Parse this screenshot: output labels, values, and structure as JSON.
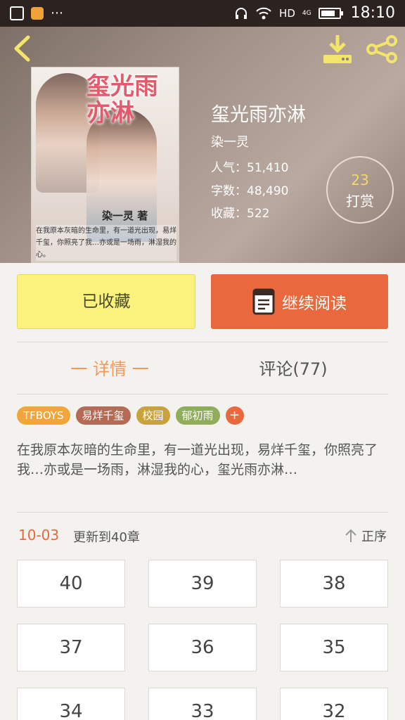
{
  "status_bar": {
    "network": "HD",
    "signal_label": "4G",
    "time": "18:10",
    "battery_level": 0.8
  },
  "book": {
    "title": "玺光雨亦淋",
    "author": "染一灵",
    "popularity": "人气：51,410",
    "word_count": "字数：48,490",
    "favorites": "收藏：522",
    "tip_count": "23",
    "tip_label": "打赏"
  },
  "cover": {
    "title": "玺光雨亦淋",
    "author_credit": "染一灵 著",
    "blurb": "在我原本灰暗的生命里，有一道光出现，易烊千玺，你照亮了我…亦或是一场雨，淋湿我的心。"
  },
  "actions": {
    "favorite_label": "已收藏",
    "read_label": "继续阅读"
  },
  "tabs": {
    "details": "一 详情 一",
    "comments": "评论(77)"
  },
  "tags": [
    {
      "label": "TFBOYS",
      "color": "#f0a63a"
    },
    {
      "label": "易烊千玺",
      "color": "#b46a55"
    },
    {
      "label": "校园",
      "color": "#c9a23c"
    },
    {
      "label": "郁初雨",
      "color": "#8fad5a"
    }
  ],
  "tag_add_label": "+",
  "description": "在我原本灰暗的生命里，有一道光出现，易烊千玺，你照亮了我…亦或是一场雨，淋湿我的心，玺光雨亦淋…",
  "update": {
    "date": "10-03",
    "text": "更新到40章",
    "sort_label": "正序"
  },
  "chapters": [
    "40",
    "39",
    "38",
    "37",
    "36",
    "35",
    "34",
    "33",
    "32"
  ],
  "colors": {
    "accent": "#ea683e",
    "favorite_button": "#fbf27d",
    "tab_active": "#f29a5a"
  }
}
